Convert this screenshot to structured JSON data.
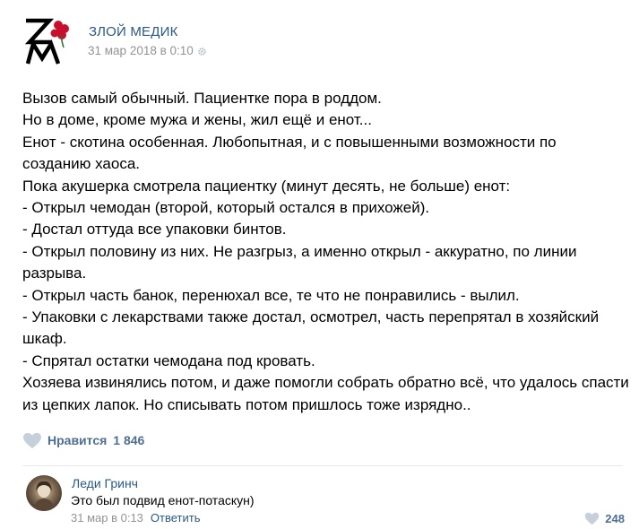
{
  "post": {
    "author": "ЗЛОЙ МЕДИК",
    "date": "31 мар 2018 в 0:10",
    "avatar_icon": "zm-logo-icon",
    "settings_icon": "gear-icon",
    "lines": [
      "Вызов самый обычный. Пациентке пора в роддом.",
      "Но в доме, кроме мужа и жены, жил ещё и енот...",
      "Енот - скотина особенная. Любопытная, и с повышенными возможности по",
      "созданию хаоса.",
      "Пока акушерка смотрела пациентку (минут десять, не больше) енот:",
      "- Открыл чемодан (второй, который остался в прихожей).",
      "- Достал оттуда все упаковки бинтов.",
      "- Открыл половину из них. Не разгрыз, а именно открыл - аккуратно, по линии",
      "разрыва.",
      "- Открыл часть банок, перенюхал все, те что не понравились - вылил.",
      "- Упаковки с лекарствами также достал, осмотрел, часть перепрятал в хозяйский",
      "шкаф.",
      "- Спрятал остатки чемодана под кровать.",
      "Хозяева извинялись потом, и даже помогли собрать обратно всё, что удалось спасти",
      "из цепких лапок. Но списывать потом пришлось тоже изрядно.."
    ],
    "likes_label": "Нравится",
    "likes_count": "1 846"
  },
  "comment": {
    "author": "Леди Гринч",
    "text": "Это был подвид енот-потаскун)",
    "date": "31 мар в 0:13",
    "reply_label": "Ответить",
    "likes_count": "248"
  },
  "colors": {
    "link": "#2a5885",
    "muted": "#939393",
    "like": "#4f6e93",
    "heart": "#c5d0db",
    "logo_red": "#c8102e"
  }
}
